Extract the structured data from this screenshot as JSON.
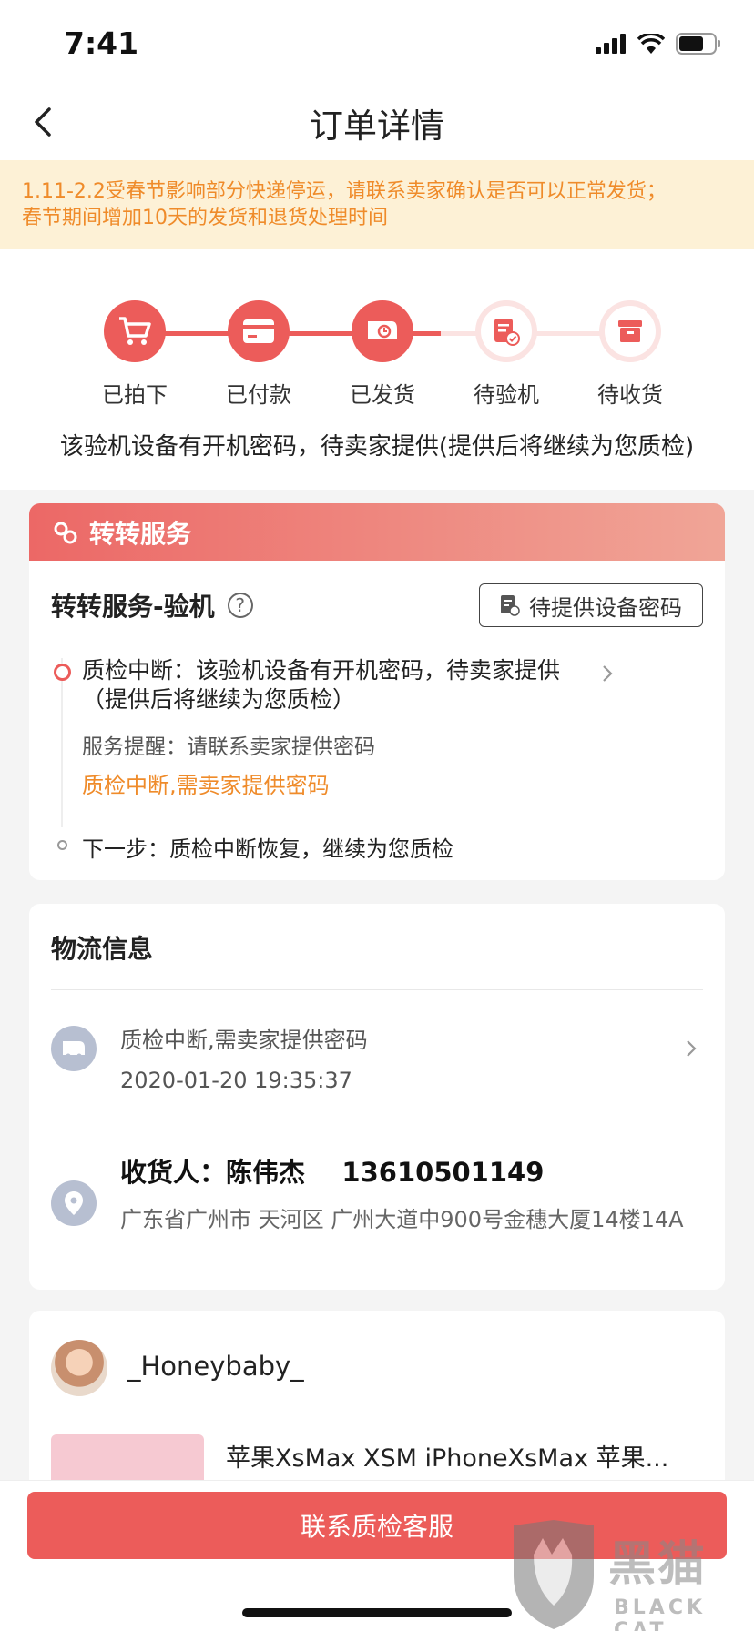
{
  "status_bar": {
    "time": "7:41"
  },
  "nav": {
    "title": "订单详情"
  },
  "notice": {
    "line1": "1.11-2.2受春节影响部分快递停运，请联系卖家确认是否可以正常发货；",
    "line2": "春节期间增加10天的发货和退货处理时间"
  },
  "progress": {
    "steps": [
      {
        "label": "已拍下",
        "state": "done",
        "icon": "cart-icon"
      },
      {
        "label": "已付款",
        "state": "done",
        "icon": "card-icon"
      },
      {
        "label": "已发货",
        "state": "done",
        "icon": "truck-icon"
      },
      {
        "label": "待验机",
        "state": "current",
        "icon": "inspect-icon"
      },
      {
        "label": "待收货",
        "state": "todo",
        "icon": "box-icon"
      }
    ],
    "message": "该验机设备有开机密码，待卖家提供(提供后将继续为您质检)"
  },
  "service": {
    "header": "转转服务",
    "title": "转转服务-验机",
    "button_label": "待提供设备密码",
    "timeline_main": "质检中断：该验机设备有开机密码，待卖家提供（提供后将继续为您质检）",
    "reminder": "服务提醒：请联系卖家提供密码",
    "warning": "质检中断,需卖家提供密码",
    "next_step": "下一步：质检中断恢复，继续为您质检"
  },
  "logistics": {
    "title": "物流信息",
    "status": "质检中断,需卖家提供密码",
    "time": "2020-01-20 19:35:37",
    "receiver_label": "收货人：",
    "receiver_name": "陈伟杰",
    "receiver_phone": "13610501149",
    "address": "广东省广州市 天河区 广州大道中900号金穗大厦14楼14A"
  },
  "seller": {
    "name": "_Honeybaby_",
    "product_title": "苹果XsMax XSM iPhoneXsMax 苹果..."
  },
  "bottom": {
    "contact_label": "联系质检客服"
  },
  "watermark": {
    "cn": "黑猫",
    "en": "BLACK CAT"
  },
  "colors": {
    "accent": "#ec5c5a",
    "warning": "#ef8b2a",
    "notice_bg": "#fdf1d6"
  }
}
